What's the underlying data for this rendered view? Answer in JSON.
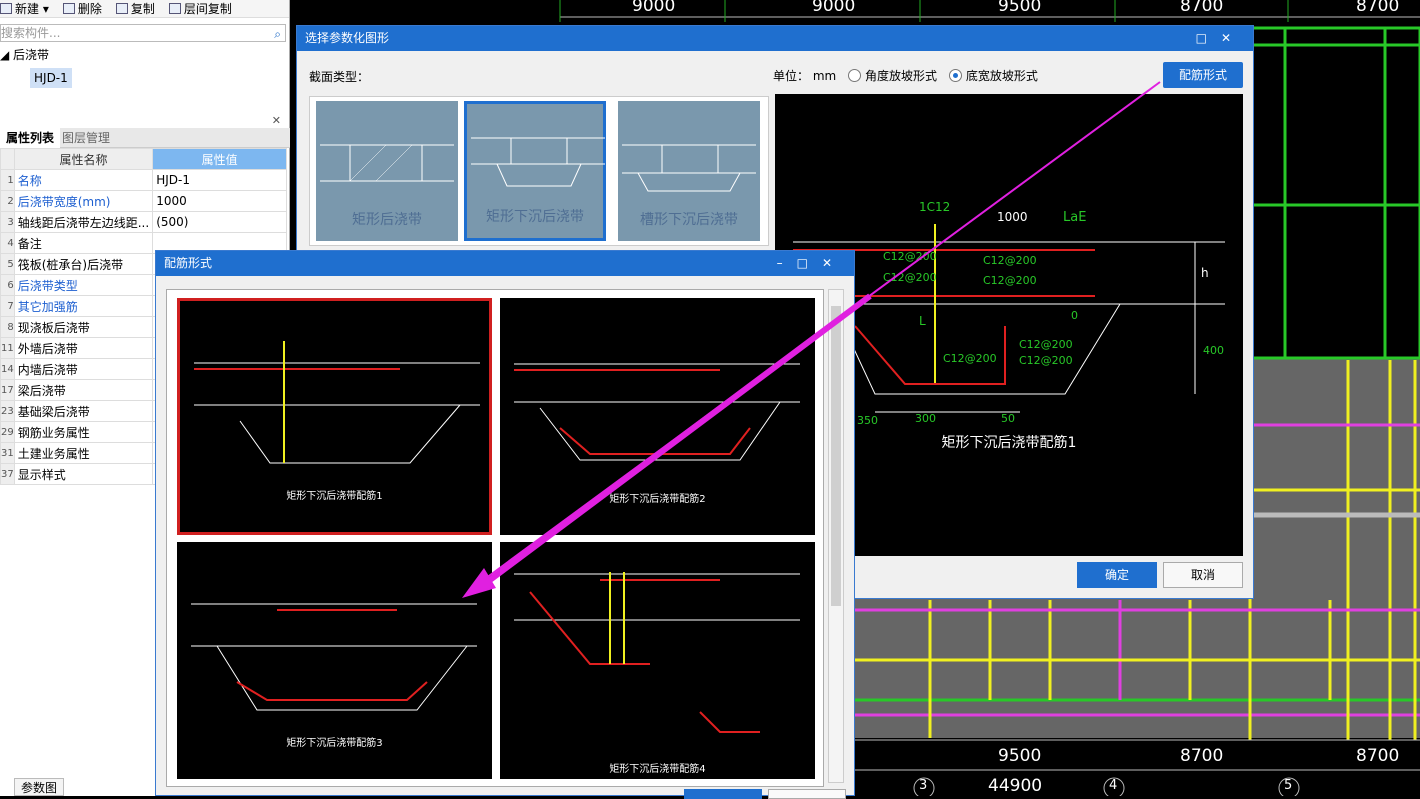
{
  "toolbar": {
    "new": "新建",
    "delete": "删除",
    "copy": "复制",
    "floor_copy": "层间复制"
  },
  "search": {
    "placeholder": "搜索构件..."
  },
  "tree": {
    "root": "后浇带",
    "item": "HJD-1"
  },
  "panel_tabs": {
    "attr": "属性列表",
    "layer": "图层管理"
  },
  "prop_table": {
    "headers": [
      "属性名称",
      "属性值"
    ],
    "rows": [
      {
        "num": "1",
        "name": "名称",
        "value": "HJD-1",
        "blue": true
      },
      {
        "num": "2",
        "name": "后浇带宽度(mm)",
        "value": "1000",
        "blue": true
      },
      {
        "num": "3",
        "name": "轴线距后浇带左边线距...",
        "value": "(500)",
        "blue": false
      },
      {
        "num": "4",
        "name": "备注",
        "value": "",
        "blue": false
      },
      {
        "num": "5",
        "name": "筏板(桩承台)后浇带",
        "value": "",
        "blue": false
      },
      {
        "num": "6",
        "name": "后浇带类型",
        "value": "",
        "blue": true
      },
      {
        "num": "7",
        "name": "其它加强筋",
        "value": "",
        "blue": true
      },
      {
        "num": "8",
        "name": "现浇板后浇带",
        "value": "",
        "blue": false
      },
      {
        "num": "11",
        "name": "外墙后浇带",
        "value": "",
        "blue": false
      },
      {
        "num": "14",
        "name": "内墙后浇带",
        "value": "",
        "blue": false
      },
      {
        "num": "17",
        "name": "梁后浇带",
        "value": "",
        "blue": false
      },
      {
        "num": "23",
        "name": "基础梁后浇带",
        "value": "",
        "blue": false
      },
      {
        "num": "29",
        "name": "钢筋业务属性",
        "value": "",
        "blue": false
      },
      {
        "num": "31",
        "name": "土建业务属性",
        "value": "",
        "blue": false
      },
      {
        "num": "37",
        "name": "显示样式",
        "value": "",
        "blue": false
      }
    ]
  },
  "bottom_tab": "参数图",
  "dialog1": {
    "title": "选择参数化图形",
    "section_label": "截面类型：",
    "unit_label": "单位： mm",
    "radio_angle": "角度放坡形式",
    "radio_width": "底宽放坡形式",
    "peijin_button": "配筋形式",
    "thumbs": [
      "矩形后浇带",
      "矩形下沉后浇带",
      "槽形下沉后浇带"
    ],
    "preview_caption": "矩形下沉后浇带配筋1",
    "preview_labels": {
      "top": "1C12",
      "width": "1000",
      "lae": "LaE",
      "h": "h",
      "r1": "C12@200",
      "r2": "C12@200",
      "r3": "C12@200",
      "r4": "C12@200",
      "l": "L",
      "c1": "C12@200",
      "c2": "C12@200",
      "c3": "C12@200",
      "d400": "400",
      "d350": "350",
      "d300": "300",
      "d50": "50",
      "zero": "0"
    },
    "ok": "确定",
    "cancel": "取消"
  },
  "dialog2": {
    "title": "配筋形式",
    "captions": [
      "矩形下沉后浇带配筋1",
      "矩形下沉后浇带配筋2",
      "矩形下沉后浇带配筋3",
      "矩形下沉后浇带配筋4"
    ]
  },
  "cad": {
    "top_dims": [
      "9000",
      "9000",
      "9500",
      "8700",
      "8700"
    ],
    "bottom_dims": [
      "9500",
      "8700",
      "8700"
    ],
    "total": "44900",
    "axis": [
      "3",
      "4",
      "5"
    ]
  },
  "colors": {
    "accent": "#1f6fcf",
    "arrow": "#e020e0",
    "cad_green": "#28c828",
    "cad_yellow": "#f0f020",
    "cad_magenta": "#e040e0"
  }
}
